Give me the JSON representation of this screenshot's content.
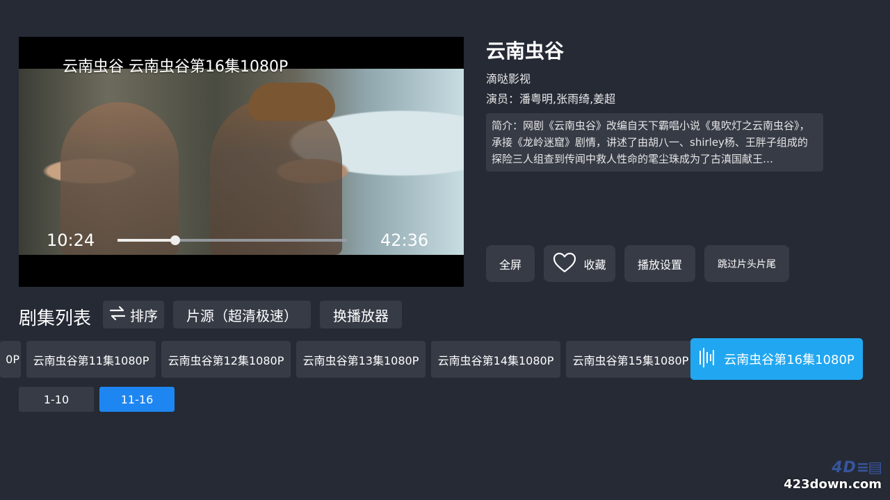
{
  "player": {
    "overlay_title": "云南虫谷 云南虫谷第16集1080P",
    "time_current": "10:24",
    "time_total": "42:36",
    "progress": 0.25
  },
  "info": {
    "title": "云南虫谷",
    "studio": "滴哒影视",
    "cast": "演员：潘粤明,张雨绮,姜超",
    "synopsis": "简介：网剧《云南虫谷》改编自天下霸唱小说《鬼吹灯之云南虫谷》，承接《龙岭迷窟》剧情，讲述了由胡八一、shirley杨、王胖子组成的探险三人组查到传闻中救人性命的雮尘珠成为了古滇国献王…"
  },
  "actions": {
    "fullscreen": "全屏",
    "favorite": "收藏",
    "favorite_icon": "heart-icon",
    "settings": "播放设置",
    "skip": "跳过片头片尾"
  },
  "episodes_header": {
    "title": "剧集列表",
    "sort": "排序",
    "sort_icon": "swap-icon",
    "source": "片源（超清极速）",
    "switch_player": "换播放器"
  },
  "episodes": {
    "partial": "0P",
    "items": [
      "云南虫谷第11集1080P",
      "云南虫谷第12集1080P",
      "云南虫谷第13集1080P",
      "云南虫谷第14集1080P",
      "云南虫谷第15集1080P",
      "云南虫谷第16集1080P"
    ],
    "active_index": 5,
    "active_icon": "playing-bars-icon",
    "active_color": "#21a7f1"
  },
  "pages": {
    "items": [
      "1-10",
      "11-16"
    ],
    "active_index": 1,
    "active_color": "#1e86f0"
  },
  "watermark": {
    "text": "423down.com"
  }
}
